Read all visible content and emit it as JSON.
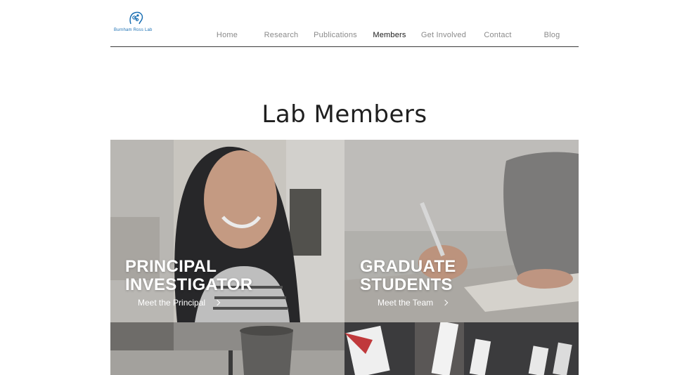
{
  "logo": {
    "text": "Burnham Ross Lab",
    "icon": "molecule-head-icon"
  },
  "nav": {
    "items": [
      {
        "label": "Home",
        "active": false
      },
      {
        "label": "Research",
        "active": false
      },
      {
        "label": "Publications",
        "active": false
      },
      {
        "label": "Members",
        "active": true
      },
      {
        "label": "Get Involved",
        "active": false
      },
      {
        "label": "Contact",
        "active": false
      },
      {
        "label": "Blog",
        "active": false
      }
    ]
  },
  "page": {
    "title": "Lab Members"
  },
  "cards": [
    {
      "heading_line1": "PRINCIPAL",
      "heading_line2": "INVESTIGATOR",
      "link": "Meet the Principal"
    },
    {
      "heading_line1": "GRADUATE",
      "heading_line2": "STUDENTS",
      "link": "Meet the Team"
    }
  ],
  "colors": {
    "logo_blue": "#1a6fb3",
    "nav_active": "#1a1a1a",
    "nav_inactive": "#8a8a8a",
    "card_text": "#ffffff"
  }
}
